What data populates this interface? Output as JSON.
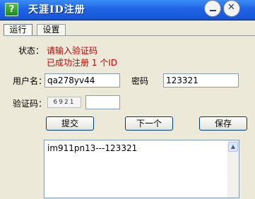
{
  "window": {
    "title": "天涯ID注册",
    "help_label": "?"
  },
  "tabs": [
    {
      "label": "运行"
    },
    {
      "label": "设置"
    }
  ],
  "form": {
    "status_label": "状态：",
    "status_line1": "请输入验证码",
    "status_line2": "已成功注册 1 个ID",
    "username_label": "用户名：",
    "username_value": "qa278yv44",
    "password_label": "密码",
    "password_value": "123321",
    "captcha_label": "验证码：",
    "captcha_image_text": "6921",
    "captcha_value": ""
  },
  "buttons": {
    "submit": "提交",
    "next": "下一个",
    "save": "保存"
  },
  "log": {
    "lines": [
      "im911pn13---123321"
    ]
  },
  "colors": {
    "titlebar": "#1F64E4",
    "status_text": "#C40000"
  }
}
